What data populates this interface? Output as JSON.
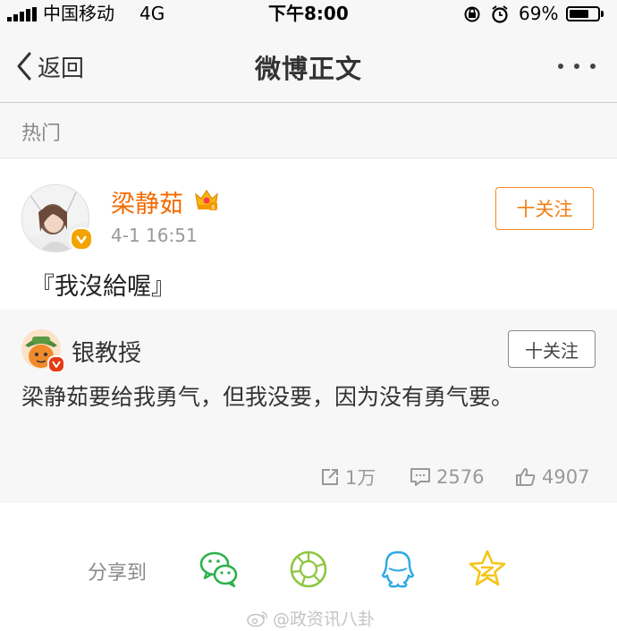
{
  "status_bar": {
    "carrier": "中国移动",
    "network": "4G",
    "time": "下午8:00",
    "battery": "69%",
    "battery_level": 0.69
  },
  "nav": {
    "back_label": "返回",
    "title": "微博正文",
    "more_icon": "more-dots-icon"
  },
  "section": {
    "label": "热门"
  },
  "post": {
    "author": "梁静茹",
    "time": "4-1 16:51",
    "follow_label": "十关注",
    "text": "『我沒給喔』",
    "author_color": "#f26a00"
  },
  "retweet": {
    "author": "银教授",
    "follow_label": "十关注",
    "text": "梁静茹要给我勇气，但我没要，因为没有勇气要。",
    "stats": {
      "reposts": "1万",
      "comments": "2576",
      "likes": "4907"
    }
  },
  "share": {
    "label": "分享到",
    "targets": [
      "wechat-icon",
      "moments-icon",
      "qq-icon",
      "qzone-icon"
    ]
  },
  "watermark": "@政资讯八卦",
  "colors": {
    "accent": "#f28c1e",
    "wechat": "#2bb24c",
    "moments": "#8cc63f",
    "qq": "#2ea8e6",
    "qzone": "#f5c518"
  }
}
